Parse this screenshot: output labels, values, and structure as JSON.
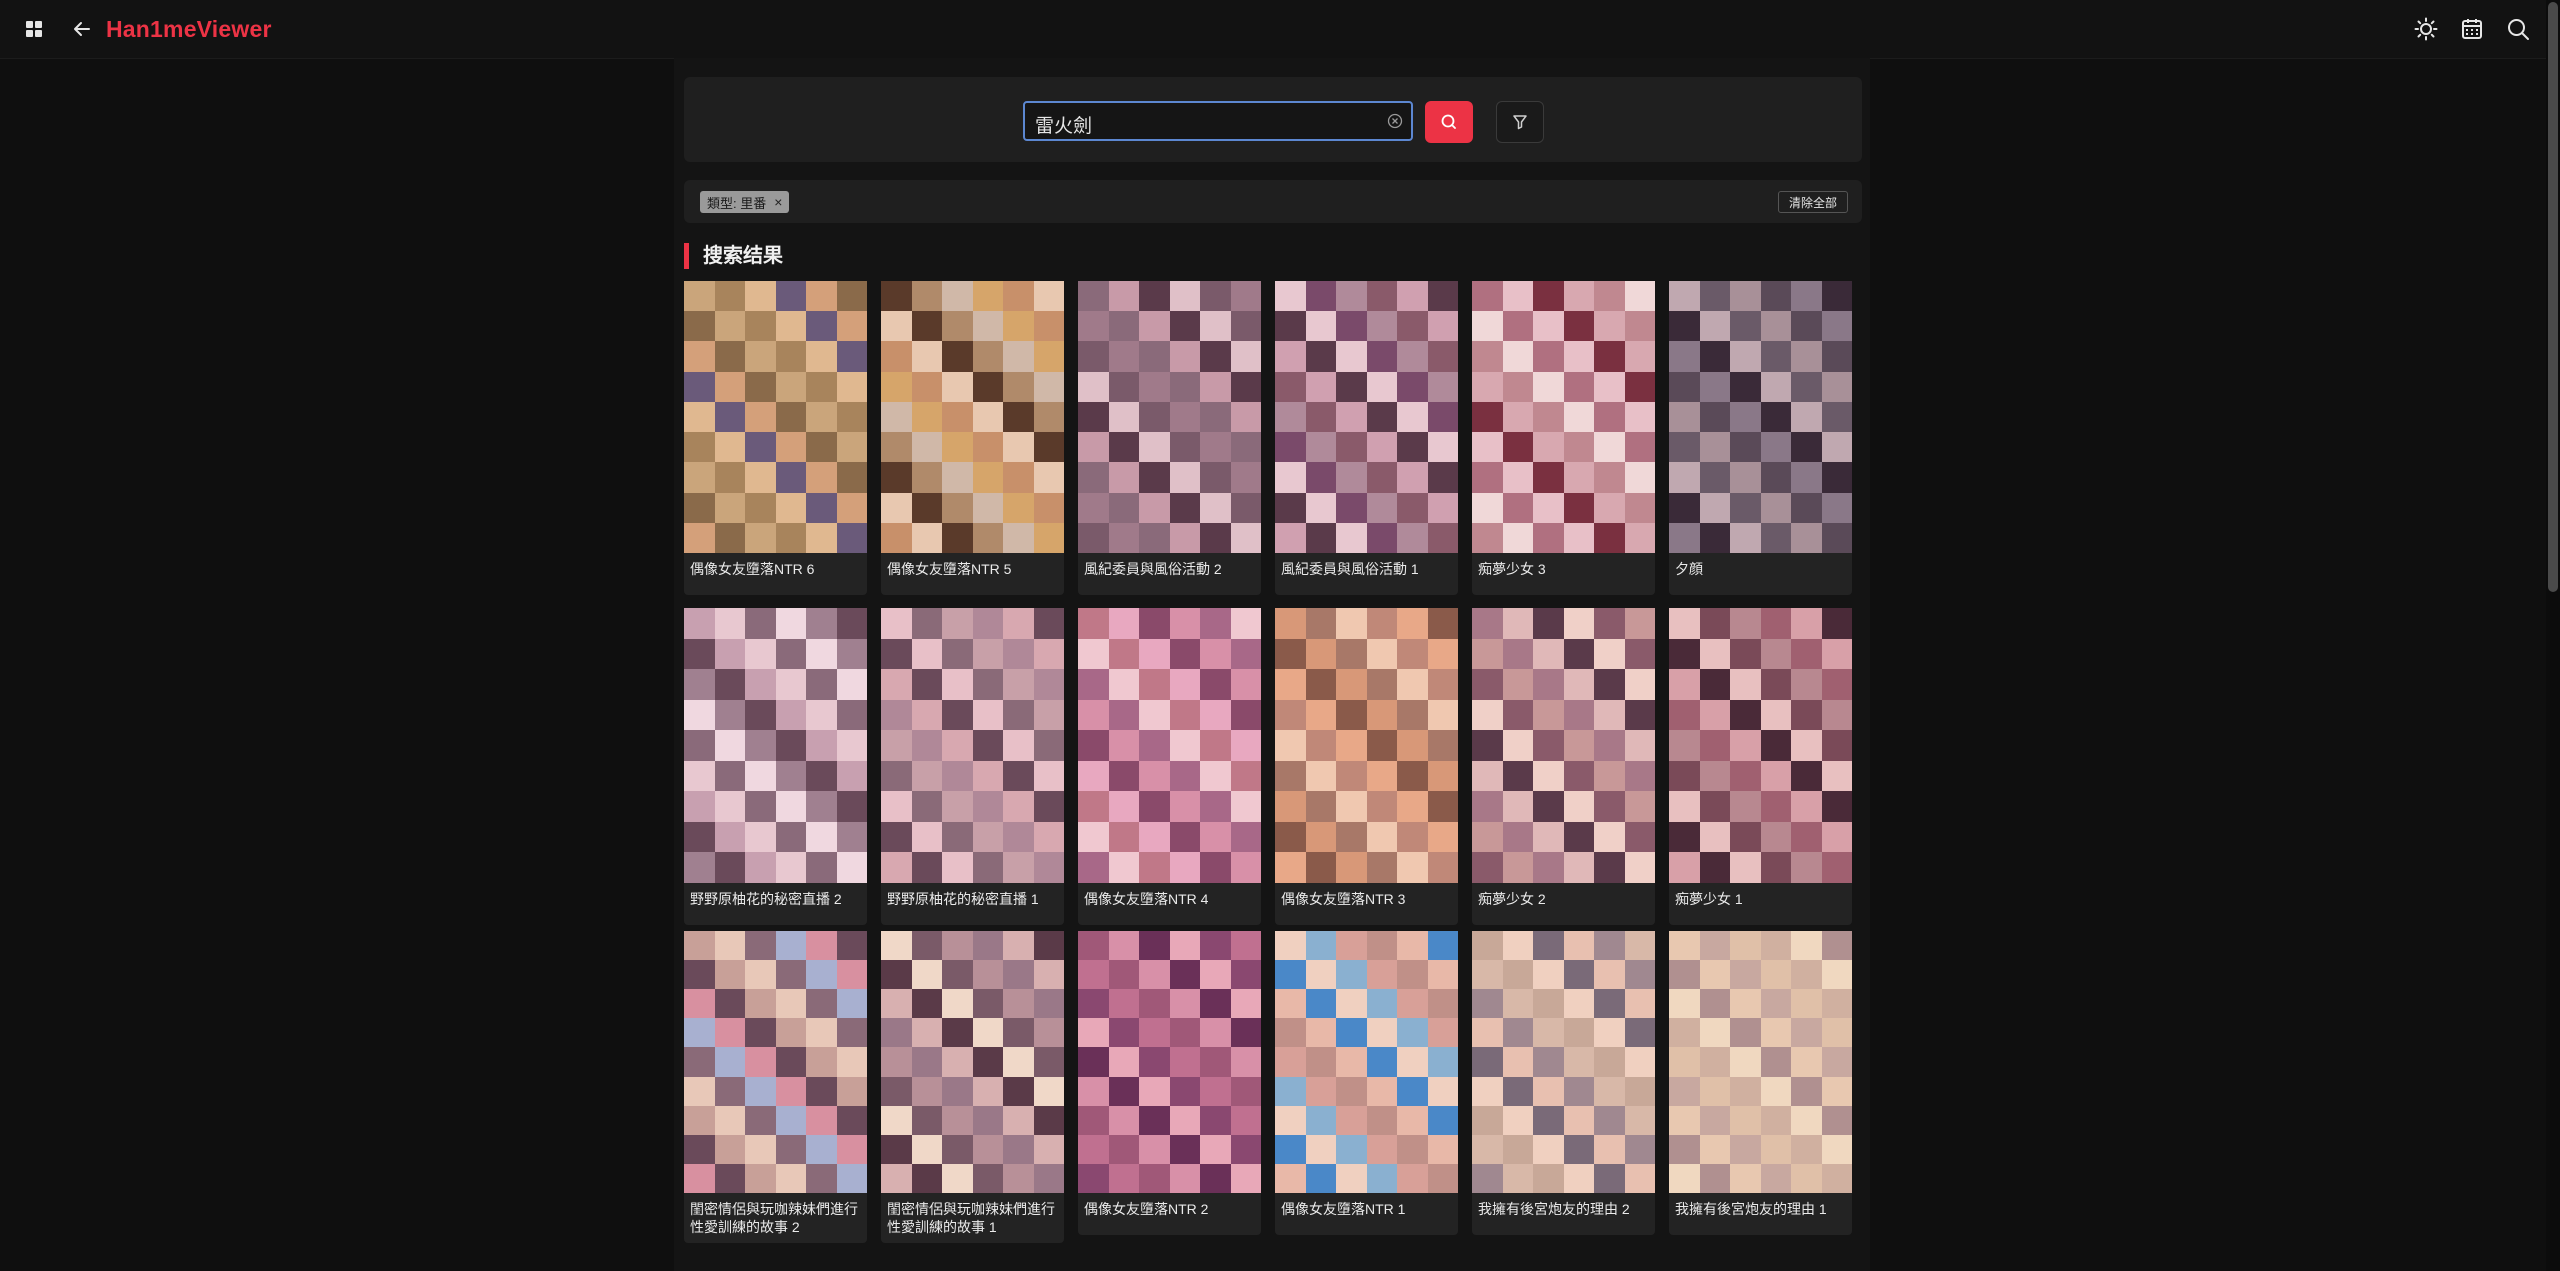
{
  "app": {
    "title": "Han1meViewer",
    "brand_color": "#ec3345"
  },
  "header": {
    "left_icons": [
      "grid-icon",
      "back-arrow-icon"
    ],
    "right_icons": [
      "sun-icon",
      "calendar-icon",
      "search-icon"
    ]
  },
  "search": {
    "query": "雷火劍",
    "submit_icon": "search-icon",
    "filter_icon": "filter-icon",
    "clear_icon": "clear-icon"
  },
  "filters": {
    "tags": [
      {
        "label": "類型: 里番"
      }
    ],
    "clear_all_label": "清除全部"
  },
  "results": {
    "title": "搜索结果",
    "items": [
      {
        "title": "偶像女友墮落NTR 6",
        "palette": [
          "#caa57b",
          "#a8845c",
          "#e0b890",
          "#6a5a7a",
          "#d4a07a",
          "#8a6a4a"
        ]
      },
      {
        "title": "偶像女友墮落NTR 5",
        "palette": [
          "#d6a56a",
          "#c8906a",
          "#e8c8b0",
          "#5a3a2a",
          "#b08a6a",
          "#d0b8a8"
        ]
      },
      {
        "title": "風紀委員與風俗活動 2",
        "palette": [
          "#8a6a7a",
          "#c89aa8",
          "#5a3a4a",
          "#e0c0c8",
          "#7a5a6a",
          "#a07a8a"
        ]
      },
      {
        "title": "風紀委員與風俗活動 1",
        "palette": [
          "#8a5a6a",
          "#d0a0b0",
          "#5a3a4a",
          "#e8c8d0",
          "#7a4a6a",
          "#b08a9a"
        ]
      },
      {
        "title": "痴夢少女 3",
        "palette": [
          "#b07080",
          "#e8c0c8",
          "#7a3040",
          "#d8a8b0",
          "#c08890",
          "#f0d8d8"
        ]
      },
      {
        "title": "夕顔",
        "palette": [
          "#5a4a58",
          "#8a7888",
          "#3a2a38",
          "#c0a8b0",
          "#6a5a68",
          "#a89098"
        ]
      },
      {
        "title": "野野原柚花的秘密直播 2",
        "palette": [
          "#c8a0b0",
          "#e8c8d0",
          "#8a6a7a",
          "#f0d8e0",
          "#a08090",
          "#6a4a5a"
        ]
      },
      {
        "title": "野野原柚花的秘密直播 1",
        "palette": [
          "#b08898",
          "#d8a8b0",
          "#6a4a5a",
          "#e8c0c8",
          "#8a6a78",
          "#c8a0a8"
        ]
      },
      {
        "title": "偶像女友墮落NTR 4",
        "palette": [
          "#c07888",
          "#e8a8c0",
          "#8a4a6a",
          "#d890a8",
          "#a86888",
          "#f0c8d0"
        ]
      },
      {
        "title": "偶像女友墮落NTR 3",
        "palette": [
          "#c08878",
          "#e8a888",
          "#8a5a4a",
          "#d89878",
          "#a87868",
          "#f0c8b0"
        ]
      },
      {
        "title": "痴夢少女 2",
        "palette": [
          "#a87888",
          "#e0b8b8",
          "#5a3a4a",
          "#f0d0c8",
          "#8a5a6a",
          "#c89898"
        ]
      },
      {
        "title": "痴夢少女 1",
        "palette": [
          "#a06070",
          "#d8a0a8",
          "#4a2a38",
          "#e8c0c0",
          "#7a4a58",
          "#b88890"
        ]
      },
      {
        "title": "閨密情侶與玩咖辣妹們進行性愛訓練的故事 2",
        "palette": [
          "#c8a098",
          "#e8c8b8",
          "#8a6a78",
          "#a8b0d0",
          "#d890a0",
          "#6a4a5a"
        ]
      },
      {
        "title": "閨密情侶與玩咖辣妹們進行性愛訓練的故事 1",
        "palette": [
          "#9a7888",
          "#d8b0b0",
          "#5a3a48",
          "#f0d8c8",
          "#7a5a68",
          "#b89098"
        ]
      },
      {
        "title": "偶像女友墮落NTR 2",
        "palette": [
          "#a05878",
          "#d890a8",
          "#6a3058",
          "#e8a8b8",
          "#8a4870",
          "#c07090"
        ]
      },
      {
        "title": "偶像女友墮落NTR 1",
        "palette": [
          "#c09088",
          "#e8b8a8",
          "#4a88c8",
          "#f0d0c0",
          "#8ab0d0",
          "#d8a098"
        ]
      },
      {
        "title": "我擁有後宮炮友的理由 2",
        "palette": [
          "#c8a898",
          "#f0d0c0",
          "#7a6a78",
          "#e8c0b0",
          "#a08890",
          "#d8b8a8"
        ]
      },
      {
        "title": "我擁有後宮炮友的理由 1",
        "palette": [
          "#d0b0a0",
          "#f0d8c0",
          "#b09090",
          "#e8c8b0",
          "#c8a8a0",
          "#e0c0a8"
        ]
      }
    ]
  }
}
